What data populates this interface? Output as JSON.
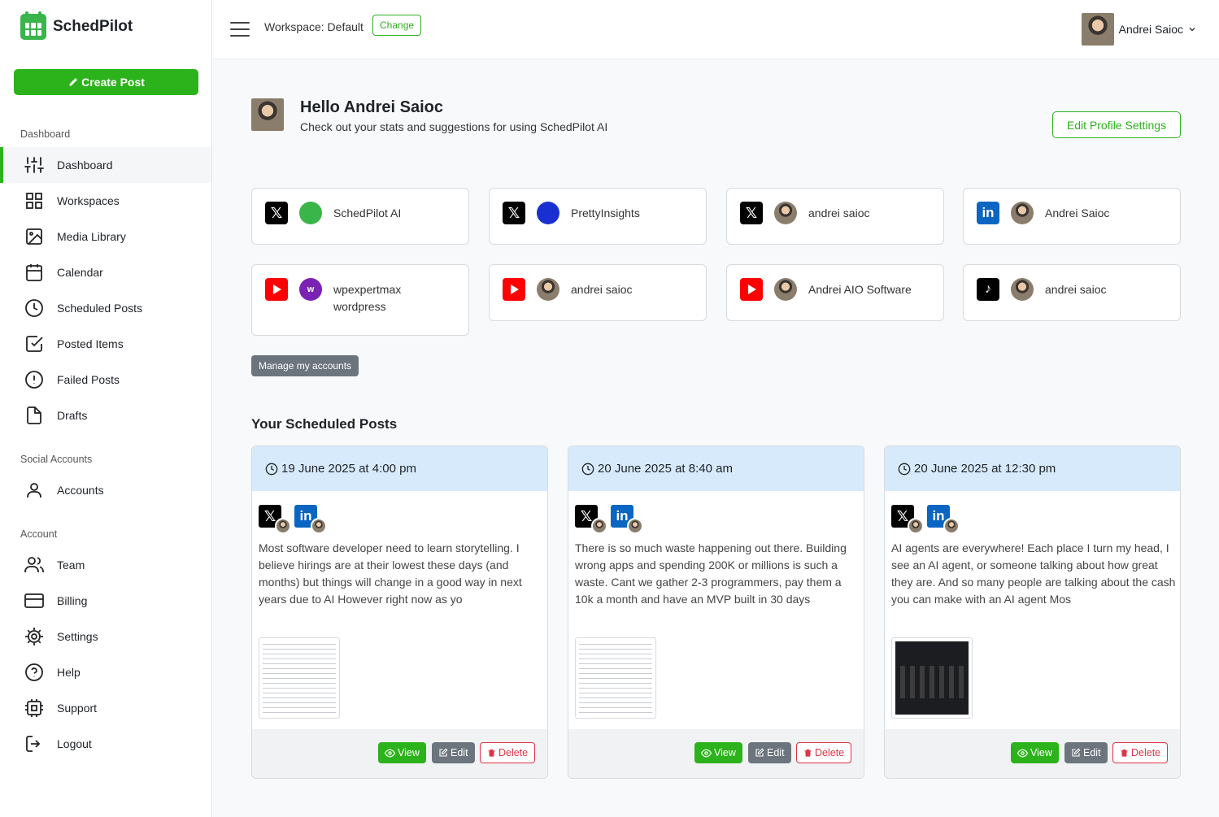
{
  "brand": {
    "name": "SchedPilot"
  },
  "sidebar": {
    "create_label": "Create Post",
    "sections": {
      "dashboard": "Dashboard",
      "social": "Social Accounts",
      "account": "Account"
    },
    "items": {
      "dashboard": "Dashboard",
      "workspaces": "Workspaces",
      "media": "Media Library",
      "calendar": "Calendar",
      "scheduled": "Scheduled Posts",
      "posted": "Posted Items",
      "failed": "Failed Posts",
      "drafts": "Drafts",
      "accounts": "Accounts",
      "team": "Team",
      "billing": "Billing",
      "settings": "Settings",
      "help": "Help",
      "support": "Support",
      "logout": "Logout"
    }
  },
  "topbar": {
    "workspace_label": "Workspace: Default",
    "change_label": "Change",
    "user_name": "Andrei Saioc"
  },
  "greeting": {
    "title": "Hello Andrei Saioc",
    "subtitle": "Check out your stats and suggestions for using SchedPilot AI",
    "edit_profile_label": "Edit Profile Settings"
  },
  "accounts": [
    {
      "platform": "x",
      "name": "SchedPilot AI"
    },
    {
      "platform": "x",
      "name": "PrettyInsights"
    },
    {
      "platform": "x",
      "name": "andrei saioc"
    },
    {
      "platform": "linkedin",
      "name": "Andrei Saioc"
    },
    {
      "platform": "youtube",
      "name": "wpexpertmax wordpress"
    },
    {
      "platform": "youtube",
      "name": "andrei saioc"
    },
    {
      "platform": "youtube",
      "name": "Andrei AIO Software"
    },
    {
      "platform": "tiktok",
      "name": "andrei saioc"
    }
  ],
  "manage_label": "Manage my accounts",
  "scheduled": {
    "title": "Your Scheduled Posts",
    "view_label": "View",
    "edit_label": "Edit",
    "delete_label": "Delete",
    "posts": [
      {
        "date": "19 June 2025 at 4:00 pm",
        "text": "Most software developer need to learn storytelling. I believe hirings are at their lowest these days (and months) but things will change in a good way in next years due to AI However right now as yo"
      },
      {
        "date": "20 June 2025 at 8:40 am",
        "text": "There is so much waste happening out there. Building wrong apps and spending 200K or millions is such a waste. Cant we gather 2-3 programmers, pay them a 10k a month and have an MVP built in 30 days"
      },
      {
        "date": "20 June 2025 at 12:30 pm",
        "text": "AI agents are everywhere! Each place I turn my head, I see an AI agent, or someone talking about how great they are. And so many people are talking about the cash you can make with an AI agent Mos"
      }
    ]
  },
  "colors": {
    "accent": "#2cb21b",
    "post_header": "#d6eafb",
    "danger": "#dc3545"
  }
}
